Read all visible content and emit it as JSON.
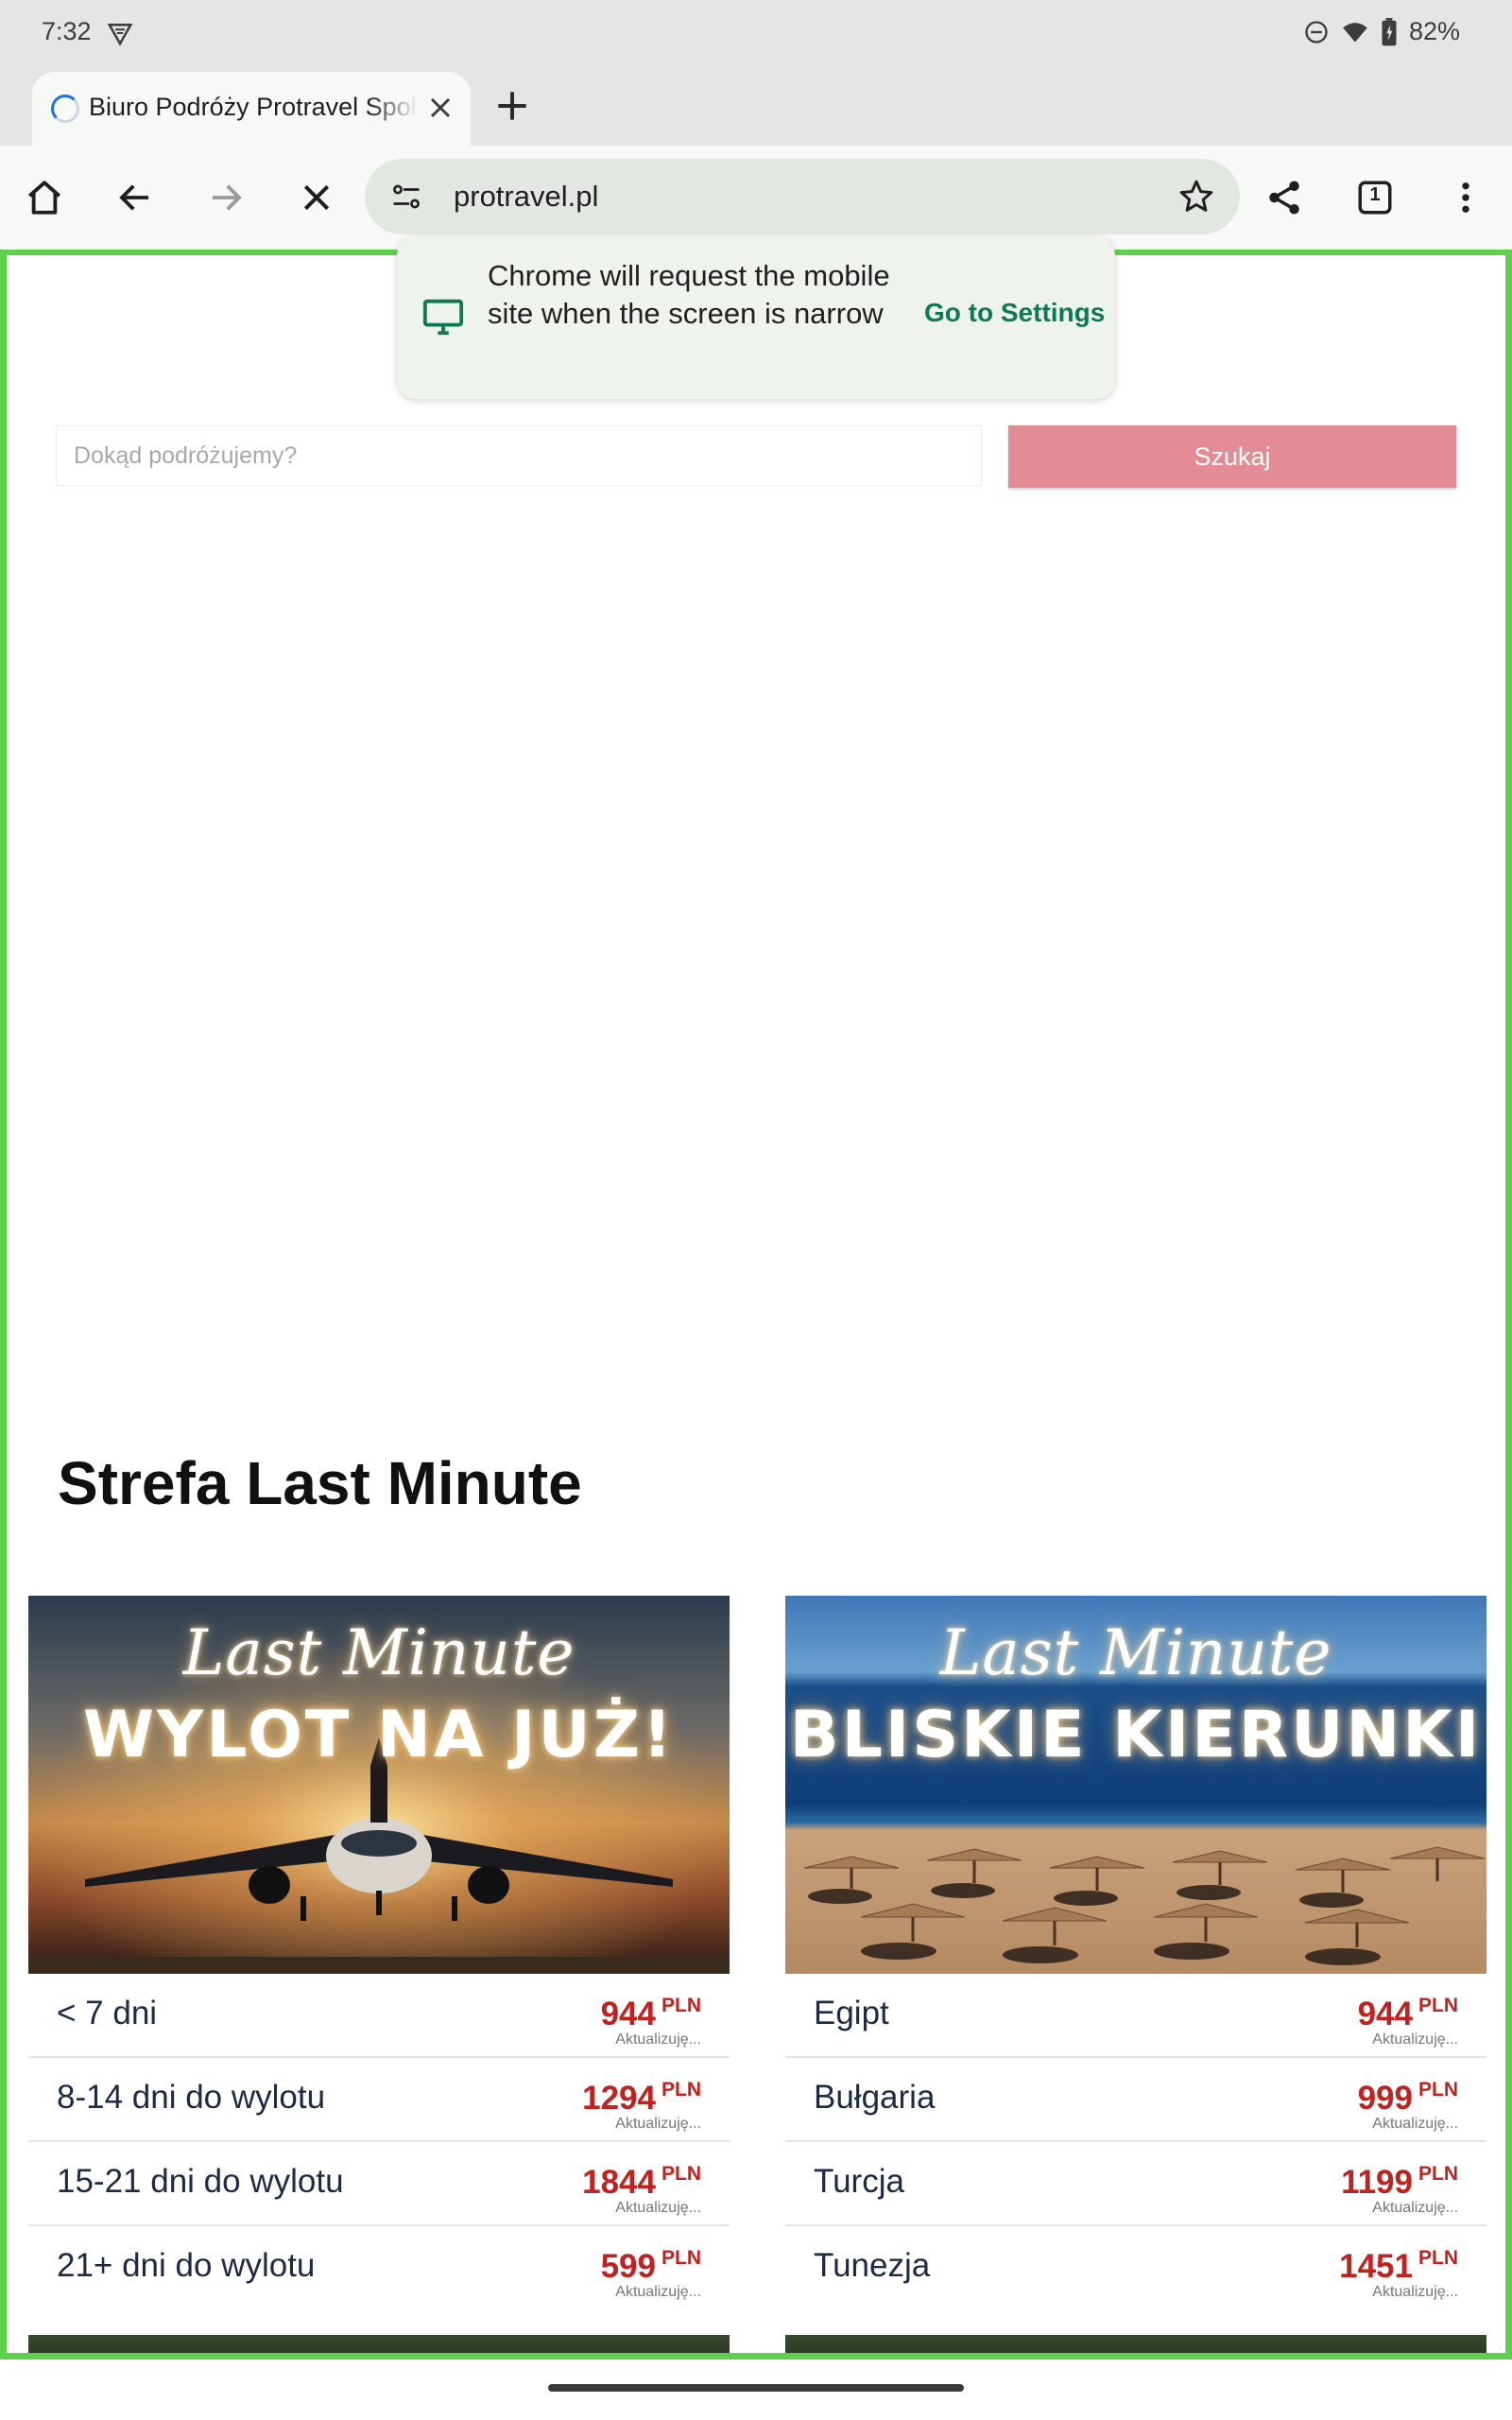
{
  "status_bar": {
    "time": "7:32",
    "battery": "82%",
    "icons": [
      "vpn-shield-icon",
      "do-not-disturb-icon",
      "wifi-icon",
      "battery-icon"
    ]
  },
  "tab": {
    "title": "Biuro Podróży Protravel Społem",
    "close_icon": "close-icon",
    "new_tab_icon": "plus-icon"
  },
  "toolbar": {
    "url": "protravel.pl",
    "icons": [
      "home-icon",
      "back-icon",
      "forward-icon",
      "stop-icon",
      "site-settings-icon",
      "star-icon",
      "share-icon",
      "tab-switcher-icon",
      "menu-icon"
    ],
    "tab_count": "1"
  },
  "toast": {
    "message": "Chrome will request the mobile site when the screen is narrow",
    "action": "Go to Settings",
    "icon": "desktop-icon",
    "accent": "#0b7a55"
  },
  "search": {
    "placeholder": "Dokąd podróżujemy?",
    "button": "Szukaj",
    "button_color": "#e48c95"
  },
  "section": {
    "title": "Strefa Last Minute"
  },
  "cards": [
    {
      "banner_script": "Last Minute",
      "banner_title": "WYLOT NA JUŻ!",
      "rows": [
        {
          "label": "< 7 dni",
          "price": "944",
          "currency": "PLN",
          "status": "Aktualizuję..."
        },
        {
          "label": "8-14 dni do wylotu",
          "price": "1294",
          "currency": "PLN",
          "status": "Aktualizuję..."
        },
        {
          "label": "15-21 dni do wylotu",
          "price": "1844",
          "currency": "PLN",
          "status": "Aktualizuję..."
        },
        {
          "label": "21+ dni do wylotu",
          "price": "599",
          "currency": "PLN",
          "status": "Aktualizuję..."
        }
      ]
    },
    {
      "banner_script": "Last Minute",
      "banner_title": "BLISKIE KIERUNKI",
      "rows": [
        {
          "label": "Egipt",
          "price": "944",
          "currency": "PLN",
          "status": "Aktualizuję..."
        },
        {
          "label": "Bułgaria",
          "price": "999",
          "currency": "PLN",
          "status": "Aktualizuję..."
        },
        {
          "label": "Turcja",
          "price": "1199",
          "currency": "PLN",
          "status": "Aktualizuję..."
        },
        {
          "label": "Tunezja",
          "price": "1451",
          "currency": "PLN",
          "status": "Aktualizuję..."
        }
      ]
    }
  ],
  "colors": {
    "price": "#c0231f",
    "viewport_border": "#5ed14a",
    "chrome_bg": "#e3e6e3"
  }
}
